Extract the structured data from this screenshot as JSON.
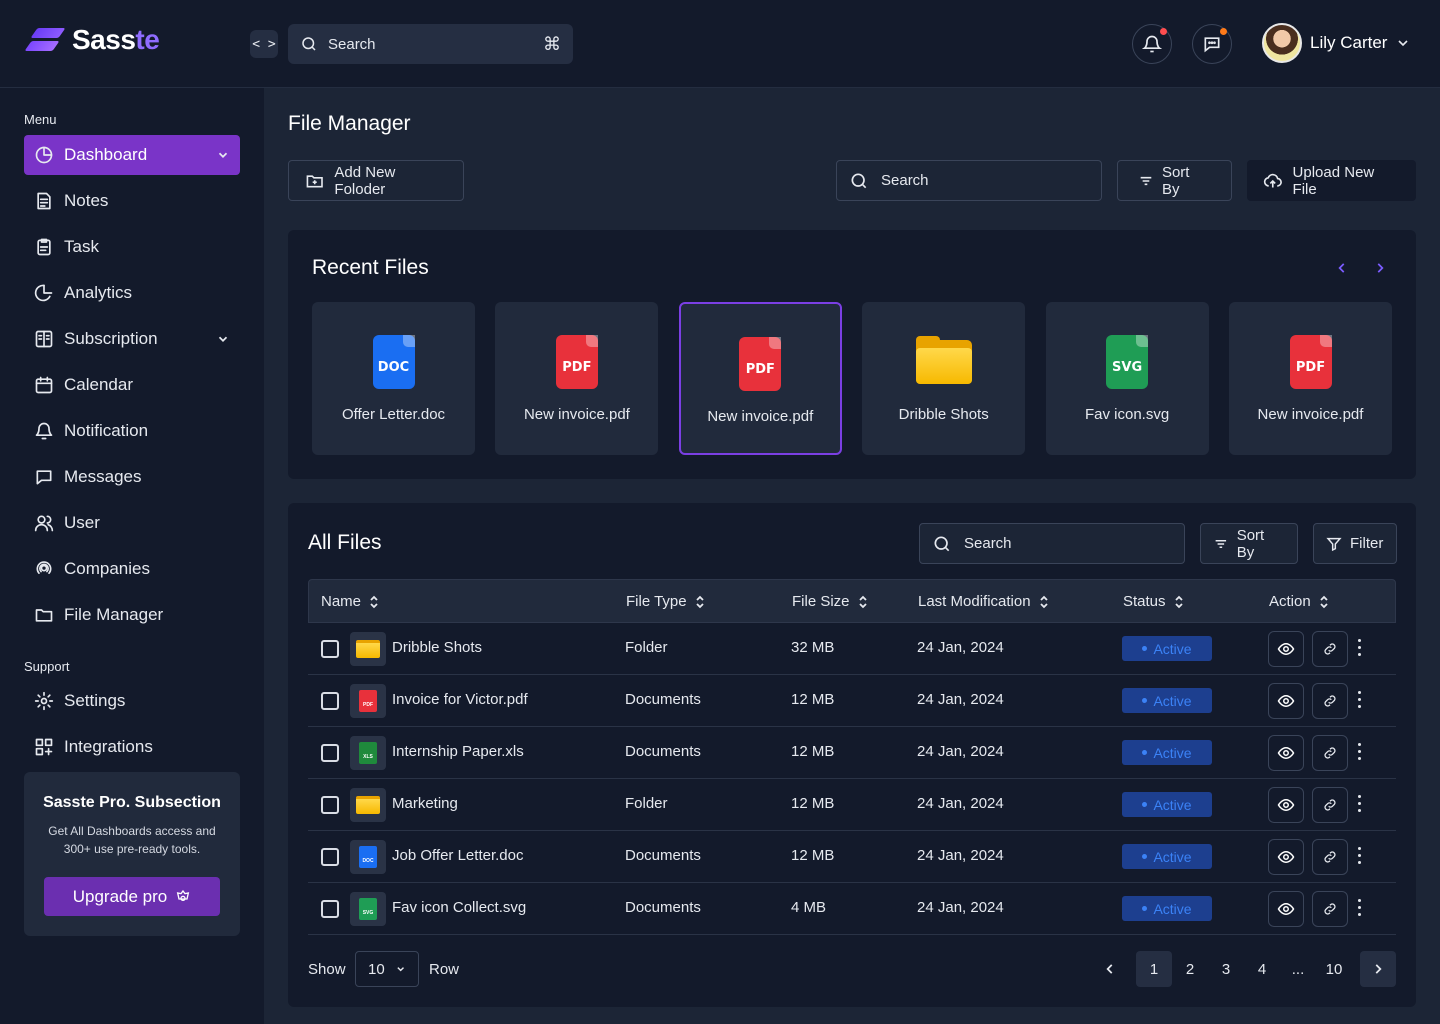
{
  "brand": {
    "name_main": "Sass",
    "name_accent": "te"
  },
  "topbar": {
    "search_placeholder": "Search",
    "shortcut_symbol": "⌘",
    "code_toggle_symbol": "< >",
    "user_name": "Lily Carter",
    "notification_dot_color": "#ff4d4f",
    "chat_dot_color": "#ff7a1a"
  },
  "sidebar": {
    "menu_label": "Menu",
    "items": [
      {
        "label": "Dashboard",
        "icon": "pie-chart-icon",
        "active": true,
        "has_chevron": true
      },
      {
        "label": "Notes",
        "icon": "notes-icon"
      },
      {
        "label": "Task",
        "icon": "task-icon"
      },
      {
        "label": "Analytics",
        "icon": "analytics-icon"
      },
      {
        "label": "Subscription",
        "icon": "subscription-icon",
        "has_chevron": true
      },
      {
        "label": "Calendar",
        "icon": "calendar-icon"
      },
      {
        "label": "Notification",
        "icon": "bell-icon"
      },
      {
        "label": "Messages",
        "icon": "message-icon"
      },
      {
        "label": "User",
        "icon": "users-icon"
      },
      {
        "label": "Companies",
        "icon": "companies-icon"
      },
      {
        "label": "File Manager",
        "icon": "folder-icon"
      }
    ],
    "support_label": "Support",
    "support_items": [
      {
        "label": "Settings",
        "icon": "gear-icon"
      },
      {
        "label": "Integrations",
        "icon": "integrations-icon"
      }
    ],
    "promo": {
      "title": "Sasste Pro. Subsection",
      "description": "Get All Dashboards access and 300+ use pre-ready tools.",
      "button_label": "Upgrade pro"
    }
  },
  "main": {
    "title": "File Manager",
    "add_folder_label": "Add New Foloder",
    "search_placeholder": "Search",
    "sort_label": "Sort By",
    "upload_label": "Upload New File"
  },
  "recent": {
    "title": "Recent Files",
    "files": [
      {
        "name": "Offer Letter.doc",
        "type": "DOC",
        "color": "#1a6ef2"
      },
      {
        "name": "New invoice.pdf",
        "type": "PDF",
        "color": "#e8313b"
      },
      {
        "name": "New invoice.pdf",
        "type": "PDF",
        "color": "#e8313b",
        "selected": true
      },
      {
        "name": "Dribble Shots",
        "type": "FOLDER",
        "color": "#f7b900"
      },
      {
        "name": "Fav icon.svg",
        "type": "SVG",
        "color": "#1f9d55"
      },
      {
        "name": "New invoice.pdf",
        "type": "PDF",
        "color": "#e8313b"
      }
    ]
  },
  "all_files": {
    "title": "All Files",
    "search_placeholder": "Search",
    "sort_label": "Sort By",
    "filter_label": "Filter",
    "columns": [
      "Name",
      "File Type",
      "File Size",
      "Last Modification",
      "Status",
      "Action"
    ],
    "rows": [
      {
        "name": "Dribble Shots",
        "kind": "folder",
        "icon_label": "",
        "icon_color": "#f7b900",
        "file_type": "Folder",
        "size": "32 MB",
        "modified": "24 Jan, 2024",
        "status": "Active"
      },
      {
        "name": "Invoice for Victor.pdf",
        "kind": "doc",
        "icon_label": "PDF",
        "icon_color": "#e8313b",
        "file_type": "Documents",
        "size": "12 MB",
        "modified": "24 Jan, 2024",
        "status": "Active"
      },
      {
        "name": "Internship Paper.xls",
        "kind": "doc",
        "icon_label": "XLS",
        "icon_color": "#1f8a3c",
        "file_type": "Documents",
        "size": "12 MB",
        "modified": "24 Jan, 2024",
        "status": "Active"
      },
      {
        "name": "Marketing",
        "kind": "folder",
        "icon_label": "",
        "icon_color": "#f7b900",
        "file_type": "Folder",
        "size": "12 MB",
        "modified": "24 Jan, 2024",
        "status": "Active"
      },
      {
        "name": "Job Offer Letter.doc",
        "kind": "doc",
        "icon_label": "DOC",
        "icon_color": "#1a6ef2",
        "file_type": "Documents",
        "size": "12 MB",
        "modified": "24 Jan, 2024",
        "status": "Active"
      },
      {
        "name": "Fav icon Collect.svg",
        "kind": "doc",
        "icon_label": "SVG",
        "icon_color": "#1f9d55",
        "file_type": "Documents",
        "size": "4 MB",
        "modified": "24 Jan, 2024",
        "status": "Active"
      }
    ],
    "pagination": {
      "show_label": "Show",
      "rows_value": "10",
      "row_label": "Row",
      "pages": [
        "1",
        "2",
        "3",
        "4",
        "...",
        "10"
      ],
      "current_page": "1"
    }
  },
  "colors": {
    "accent": "#7a34c8",
    "status_active": "#3b82f6",
    "status_bg": "#1d3f8f"
  }
}
